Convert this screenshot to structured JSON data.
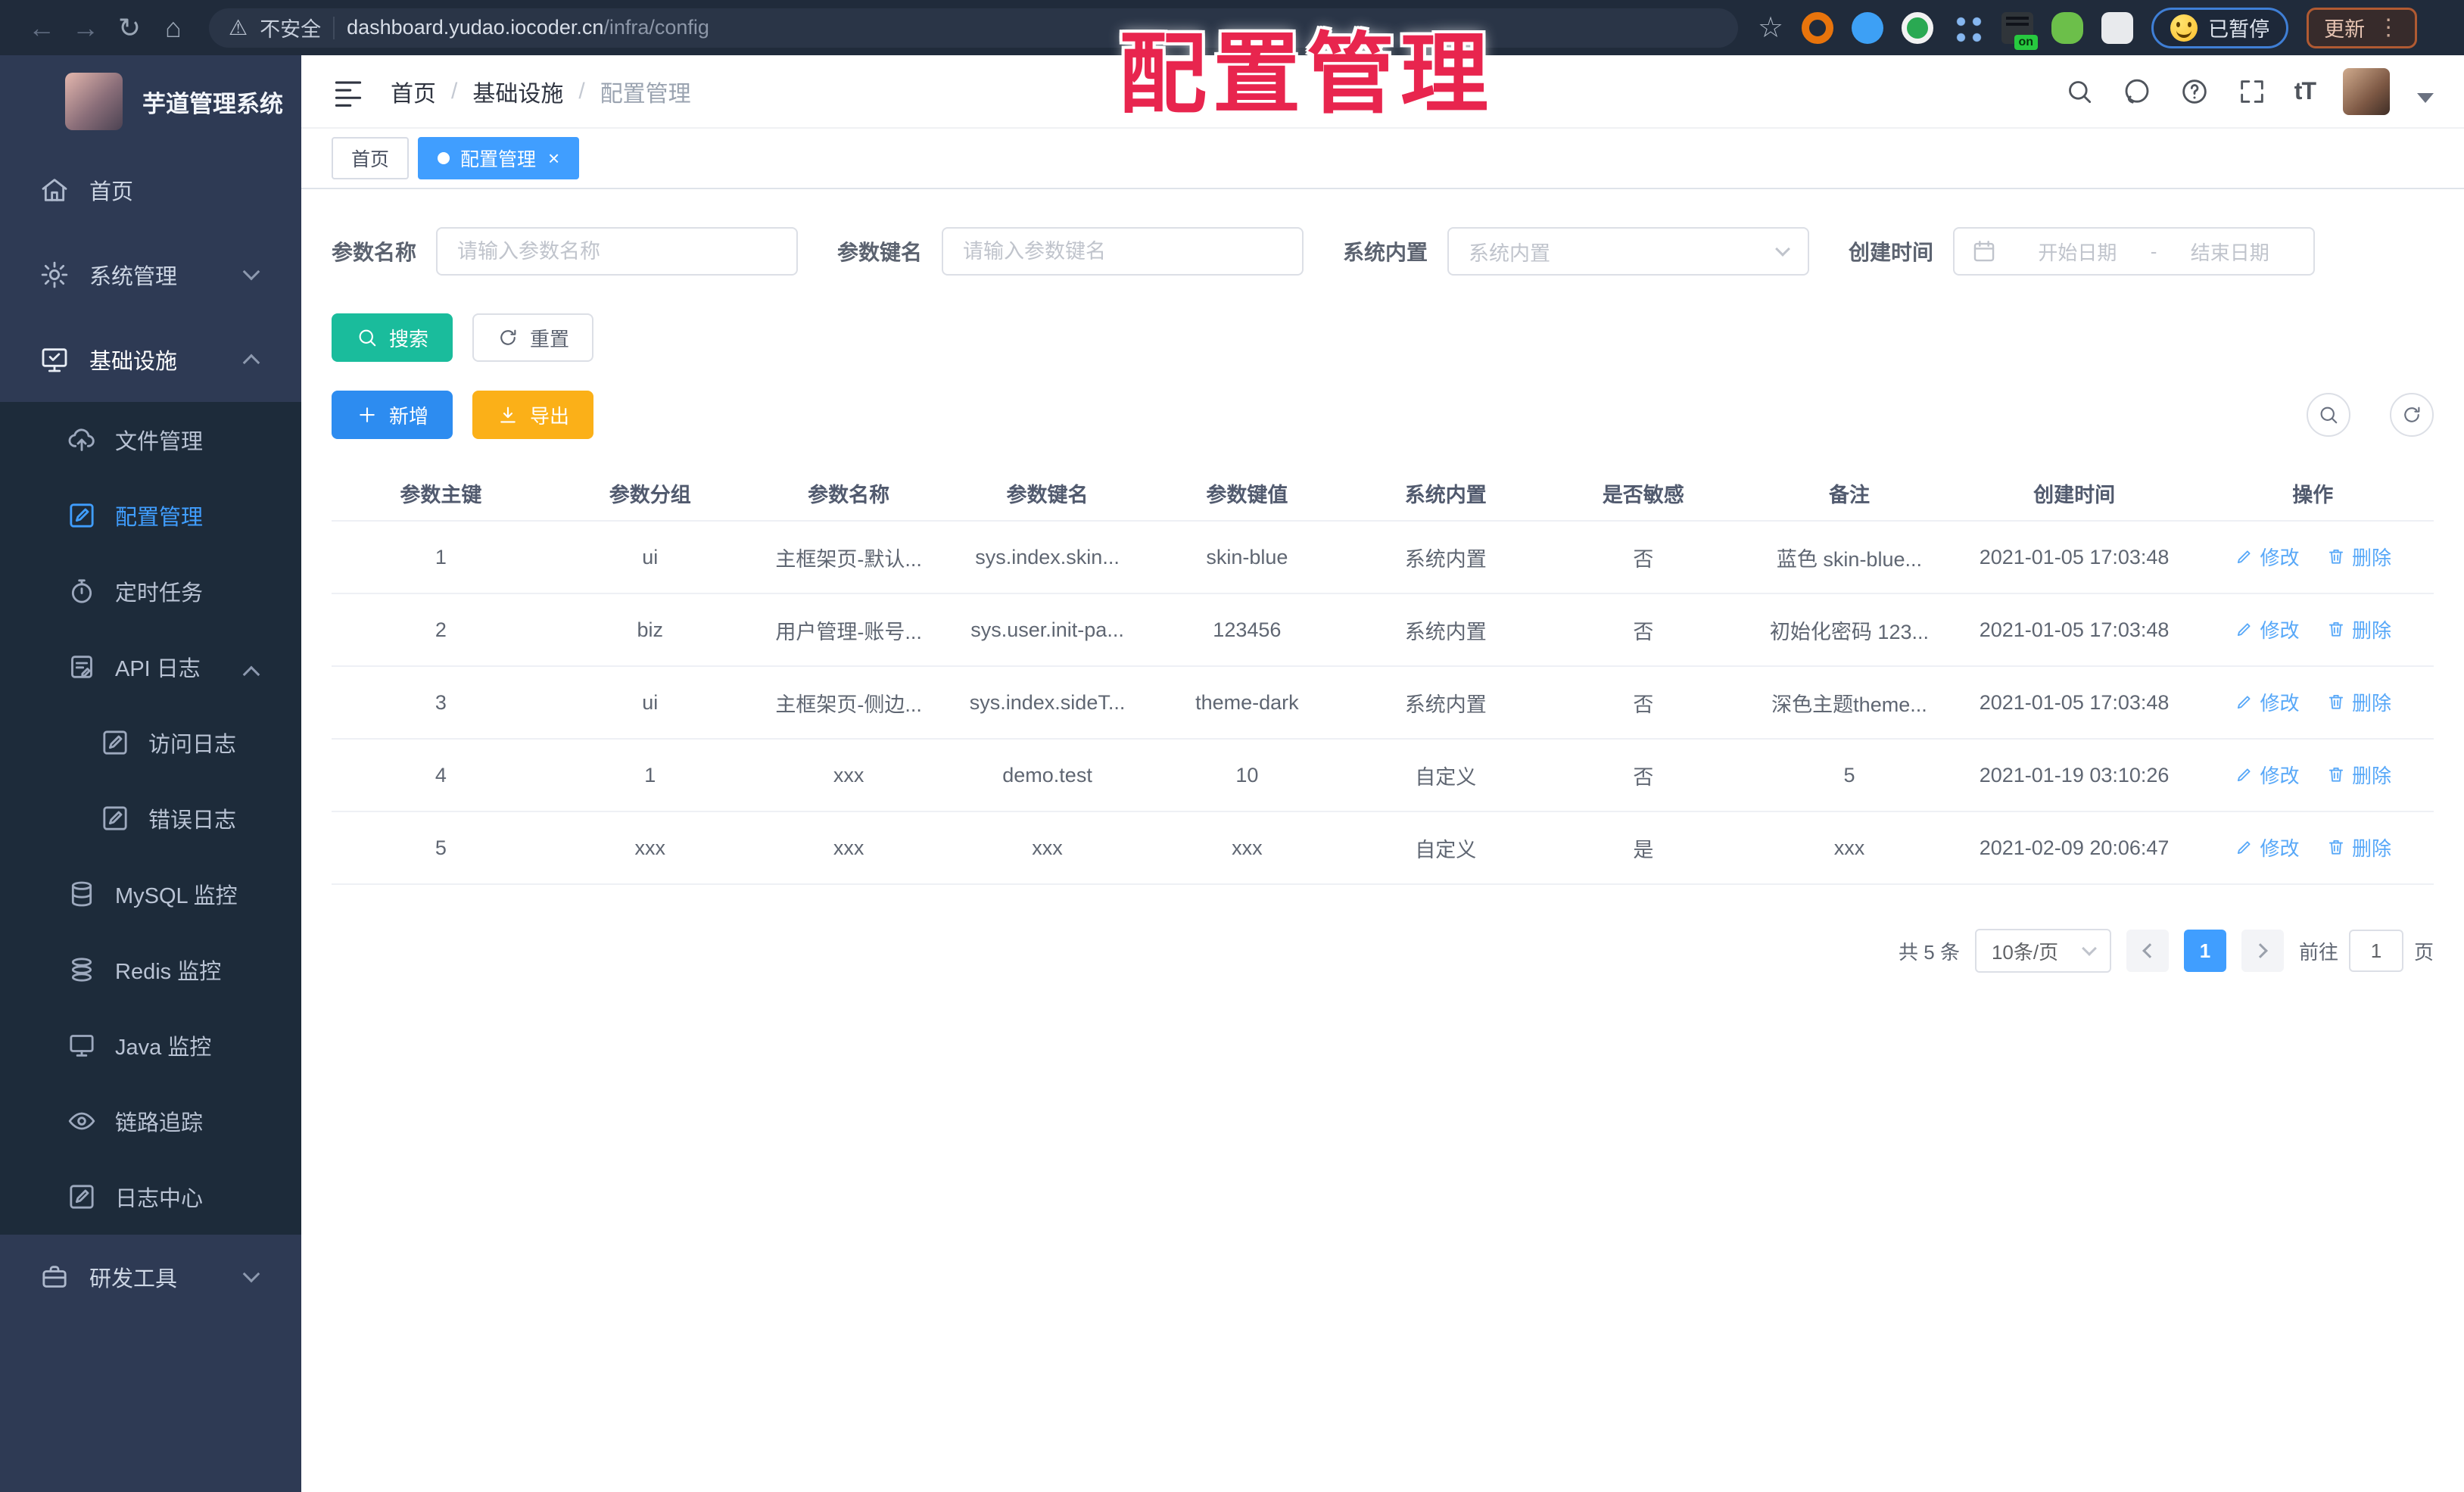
{
  "browser": {
    "insecure_label": "不安全",
    "url_host": "dashboard.yudao.iocoder.cn",
    "url_path": "/infra/config",
    "ext_on_badge": "on",
    "paused_label": "已暂停",
    "update_label": "更新"
  },
  "overlay_title": "配置管理",
  "sidebar": {
    "app_title": "芋道管理系统",
    "items": [
      "首页",
      "系统管理",
      "基础设施",
      "文件管理",
      "配置管理",
      "定时任务",
      "API 日志",
      "访问日志",
      "错误日志",
      "MySQL 监控",
      "Redis 监控",
      "Java 监控",
      "链路追踪",
      "日志中心",
      "研发工具"
    ]
  },
  "header": {
    "breadcrumb": [
      "首页",
      "基础设施",
      "配置管理"
    ],
    "separator": "/",
    "tabs": [
      {
        "label": "首页",
        "active": false
      },
      {
        "label": "配置管理",
        "active": true
      }
    ]
  },
  "filters": {
    "name_label": "参数名称",
    "name_placeholder": "请输入参数名称",
    "key_label": "参数键名",
    "key_placeholder": "请输入参数键名",
    "type_label": "系统内置",
    "type_placeholder": "系统内置",
    "date_label": "创建时间",
    "date_start_placeholder": "开始日期",
    "date_sep": "-",
    "date_end_placeholder": "结束日期",
    "search_label": "搜索",
    "reset_label": "重置"
  },
  "toolbar": {
    "add_label": "新增",
    "export_label": "导出"
  },
  "table": {
    "columns": [
      "参数主键",
      "参数分组",
      "参数名称",
      "参数键名",
      "参数键值",
      "系统内置",
      "是否敏感",
      "备注",
      "创建时间",
      "操作"
    ],
    "rows": [
      [
        "1",
        "ui",
        "主框架页-默认...",
        "sys.index.skin...",
        "skin-blue",
        "系统内置",
        "否",
        "蓝色 skin-blue...",
        "2021-01-05 17:03:48"
      ],
      [
        "2",
        "biz",
        "用户管理-账号...",
        "sys.user.init-pa...",
        "123456",
        "系统内置",
        "否",
        "初始化密码 123...",
        "2021-01-05 17:03:48"
      ],
      [
        "3",
        "ui",
        "主框架页-侧边...",
        "sys.index.sideT...",
        "theme-dark",
        "系统内置",
        "否",
        "深色主题theme...",
        "2021-01-05 17:03:48"
      ],
      [
        "4",
        "1",
        "xxx",
        "demo.test",
        "10",
        "自定义",
        "否",
        "5",
        "2021-01-19 03:10:26"
      ],
      [
        "5",
        "xxx",
        "xxx",
        "xxx",
        "xxx",
        "自定义",
        "是",
        "xxx",
        "2021-02-09 20:06:47"
      ]
    ],
    "edit_label": "修改",
    "delete_label": "删除"
  },
  "pagination": {
    "total": "共 5 条",
    "page_size": "10条/页",
    "current_page": "1",
    "goto_label": "前往",
    "goto_value": "1",
    "page_unit": "页"
  }
}
